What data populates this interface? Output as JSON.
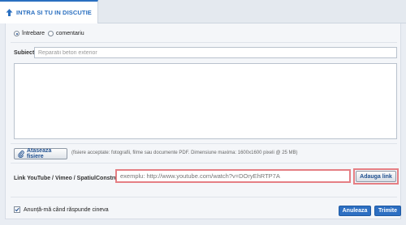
{
  "tab": {
    "label": "INTRA SI TU IN DISCUTIE",
    "icon": "arrow-up-icon",
    "accent": "#2a6fc0"
  },
  "post_type": {
    "options": [
      {
        "label": "întrebare",
        "checked": true
      },
      {
        "label": "comentariu",
        "checked": false
      }
    ]
  },
  "subject": {
    "label": "Subiect:",
    "placeholder": "Reparatii beton exterior",
    "value": ""
  },
  "attach": {
    "button_label": "Ataseaza fisiere",
    "icon": "paperclip-icon",
    "hint": "(fisiere acceptate: fotografii, filme sau documente PDF. Dimensiune maxima: 1600x1600 pixeli @ 25 MB)"
  },
  "link": {
    "label": "Link YouTube / Vimeo / SpatiulConstruit",
    "placeholder": "exemplu: http://www.youtube.com/watch?v=DOryEhRTP7A",
    "value": "",
    "button_label": "Adauga link",
    "highlight_color": "#e57f84"
  },
  "notify": {
    "label": "Anunță-mă când răspunde cineva",
    "checked": true
  },
  "actions": {
    "cancel_label": "Anuleaza",
    "submit_label": "Trimite",
    "button_color": "#2d6fc2"
  }
}
